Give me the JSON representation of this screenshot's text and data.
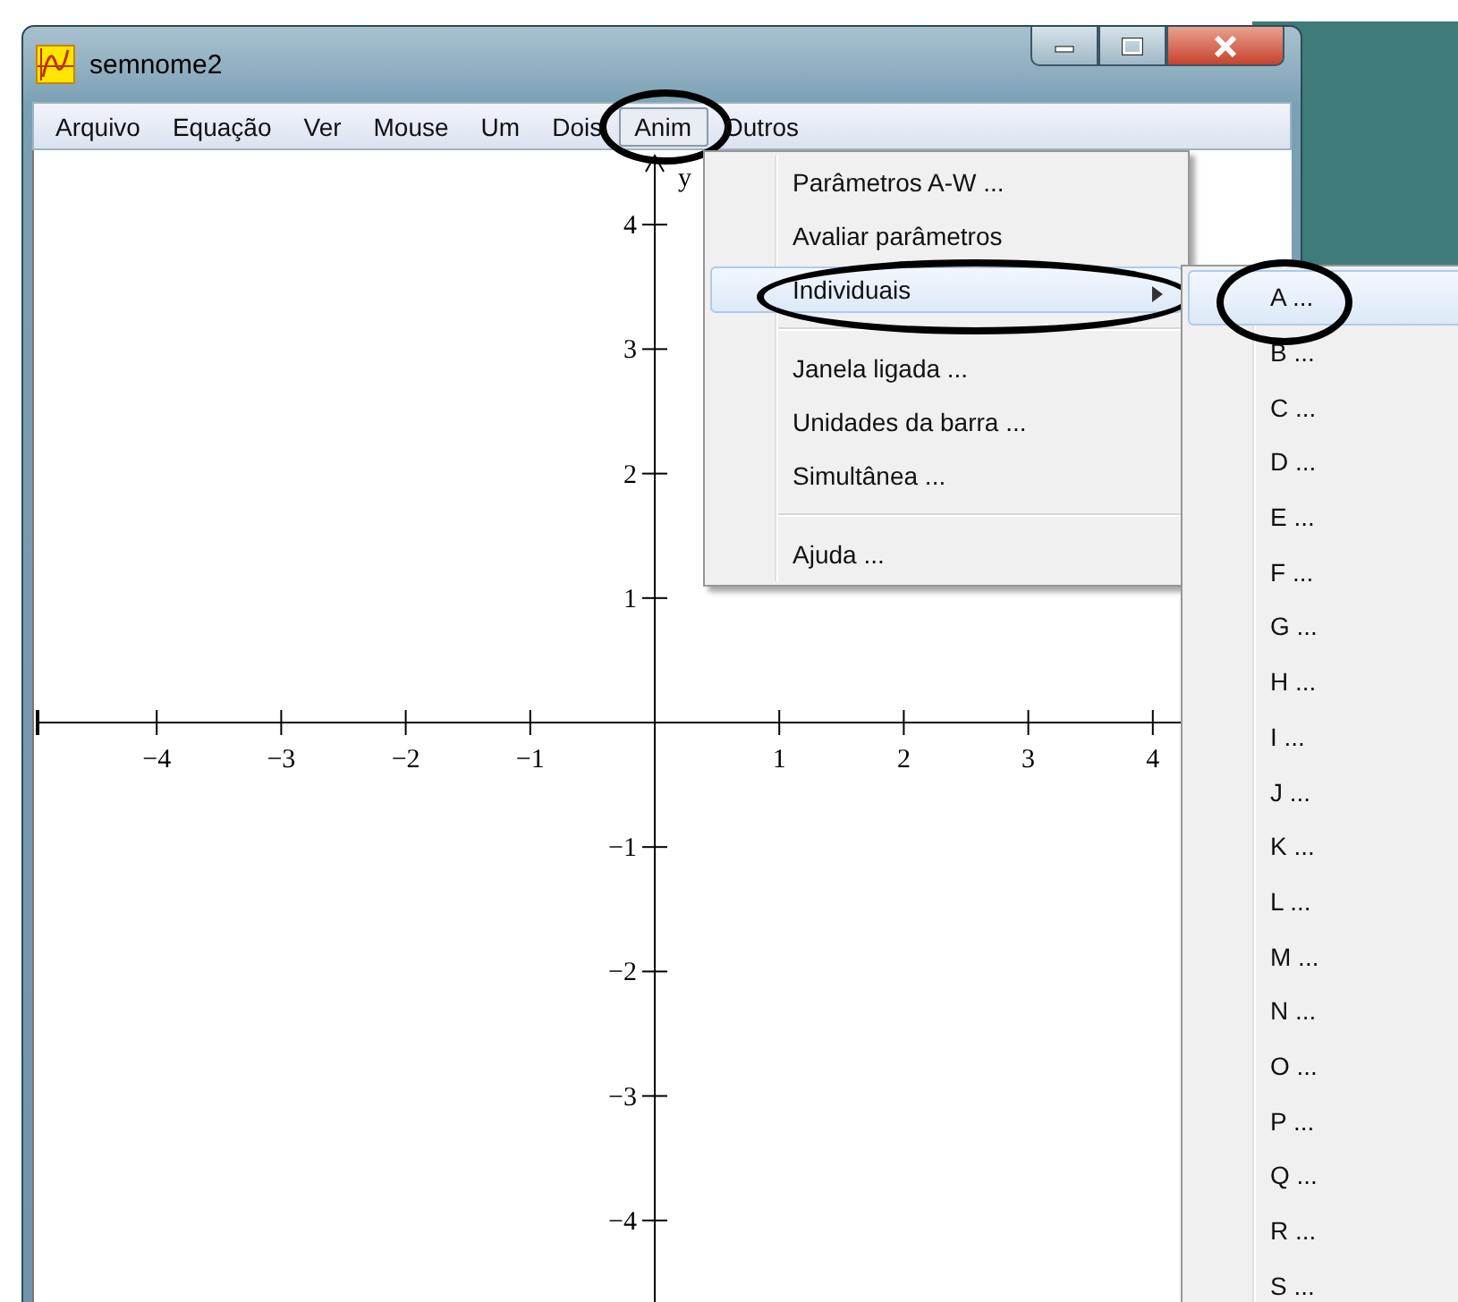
{
  "window": {
    "title": "semnome2"
  },
  "menu_bar": [
    {
      "label": "Arquivo",
      "selected": false,
      "circled": false
    },
    {
      "label": "Equação",
      "selected": false,
      "circled": false
    },
    {
      "label": "Ver",
      "selected": false,
      "circled": false
    },
    {
      "label": "Mouse",
      "selected": false,
      "circled": false
    },
    {
      "label": "Um",
      "selected": false,
      "circled": false
    },
    {
      "label": "Dois",
      "selected": false,
      "circled": false
    },
    {
      "label": "Anim",
      "selected": true,
      "circled": true
    },
    {
      "label": "Outros",
      "selected": false,
      "circled": false
    }
  ],
  "graph": {
    "y_axis_label": "y",
    "x_ticks": [
      "−4",
      "−3",
      "−2",
      "−1",
      "1",
      "2",
      "3",
      "4"
    ],
    "y_ticks": [
      "4",
      "3",
      "2",
      "1",
      "−1",
      "−2",
      "−3",
      "−4"
    ]
  },
  "menu": {
    "items": [
      {
        "kind": "item",
        "label": "Parâmetros A-W ...",
        "selected": false,
        "circled": false,
        "submenu": false
      },
      {
        "kind": "item",
        "label": "Avaliar parâmetros",
        "selected": false,
        "circled": false,
        "submenu": false
      },
      {
        "kind": "item",
        "label": "Individuais",
        "selected": true,
        "circled": true,
        "submenu": true
      },
      {
        "kind": "separator"
      },
      {
        "kind": "item",
        "label": "Janela ligada ...",
        "selected": false,
        "circled": false,
        "submenu": false
      },
      {
        "kind": "item",
        "label": "Unidades da barra ...",
        "selected": false,
        "circled": false,
        "submenu": false
      },
      {
        "kind": "item",
        "label": "Simultânea ...",
        "selected": false,
        "circled": false,
        "submenu": false
      },
      {
        "kind": "separator"
      },
      {
        "kind": "item",
        "label": "Ajuda ...",
        "selected": false,
        "circled": false,
        "submenu": false
      }
    ]
  },
  "submenu": {
    "items": [
      {
        "label": "A ...",
        "selected": true,
        "circled": true
      },
      {
        "label": "B ...",
        "selected": false,
        "circled": false
      },
      {
        "label": "C ...",
        "selected": false,
        "circled": false
      },
      {
        "label": "D ...",
        "selected": false,
        "circled": false
      },
      {
        "label": "E ...",
        "selected": false,
        "circled": false
      },
      {
        "label": "F ...",
        "selected": false,
        "circled": false
      },
      {
        "label": "G ...",
        "selected": false,
        "circled": false
      },
      {
        "label": "H ...",
        "selected": false,
        "circled": false
      },
      {
        "label": "I ...",
        "selected": false,
        "circled": false
      },
      {
        "label": "J ...",
        "selected": false,
        "circled": false
      },
      {
        "label": "K ...",
        "selected": false,
        "circled": false
      },
      {
        "label": "L ...",
        "selected": false,
        "circled": false
      },
      {
        "label": "M ...",
        "selected": false,
        "circled": false
      },
      {
        "label": "N ...",
        "selected": false,
        "circled": false
      },
      {
        "label": "O ...",
        "selected": false,
        "circled": false
      },
      {
        "label": "P ...",
        "selected": false,
        "circled": false
      },
      {
        "label": "Q ...",
        "selected": false,
        "circled": false
      },
      {
        "label": "R ...",
        "selected": false,
        "circled": false
      },
      {
        "label": "S ...",
        "selected": false,
        "circled": false
      }
    ]
  }
}
